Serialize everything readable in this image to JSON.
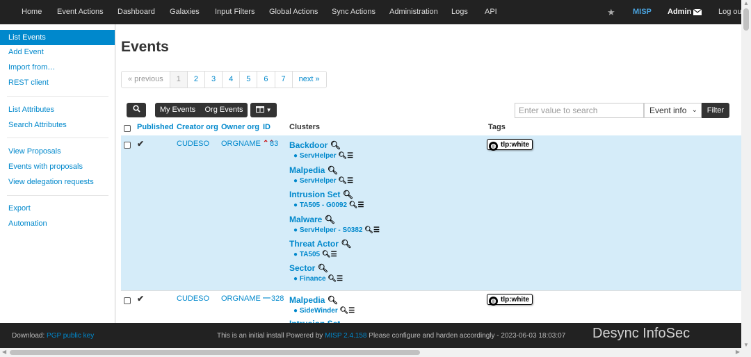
{
  "nav": {
    "home": "Home",
    "event_actions": "Event Actions",
    "dashboard": "Dashboard",
    "galaxies": "Galaxies",
    "input_filters": "Input Filters",
    "global_actions": "Global Actions",
    "sync_actions": "Sync Actions",
    "administration": "Administration",
    "logs": "Logs",
    "api": "API",
    "brand": "MISP",
    "user": "Admin",
    "logout": "Log out"
  },
  "sidebar": {
    "items": [
      "List Events",
      "Add Event",
      "Import from…",
      "REST client",
      "List Attributes",
      "Search Attributes",
      "View Proposals",
      "Events with proposals",
      "View delegation requests",
      "Export",
      "Automation"
    ]
  },
  "page": {
    "title": "Events"
  },
  "pagination": {
    "previous": "« previous",
    "pages": [
      "1",
      "2",
      "3",
      "4",
      "5",
      "6",
      "7"
    ],
    "next": "next »"
  },
  "toolbar": {
    "my_events": "My Events",
    "org_events": "Org Events",
    "search_placeholder": "Enter value to search",
    "field_select": "Event info",
    "filter": "Filter"
  },
  "table": {
    "headers": {
      "published": "Published",
      "creator_org": "Creator org",
      "owner_org": "Owner org",
      "id": "ID",
      "clusters": "Clusters",
      "tags": "Tags"
    },
    "rows": [
      {
        "creator_org": "CUDESO",
        "owner_org": "ORGNAME",
        "id": "83",
        "tag": "tlp:white",
        "clusters": [
          {
            "name": "Backdoor",
            "value": "ServHelper"
          },
          {
            "name": "Malpedia",
            "value": "ServHelper"
          },
          {
            "name": "Intrusion Set",
            "value": "TA505 - G0092"
          },
          {
            "name": "Malware",
            "value": "ServHelper - S0382"
          },
          {
            "name": "Threat Actor",
            "value": "TA505"
          },
          {
            "name": "Sector",
            "value": "Finance"
          }
        ]
      },
      {
        "creator_org": "CUDESO",
        "owner_org": "ORGNAME",
        "id": "328",
        "tag": "tlp:white",
        "clusters": [
          {
            "name": "Malpedia",
            "value": "SideWinder"
          },
          {
            "name": "Intrusion Set",
            "value": ""
          }
        ]
      }
    ]
  },
  "footer": {
    "download_label": "Download:",
    "pgp_link": "PGP public key",
    "notice_pre": "This is an initial install Powered by",
    "version": "MISP 2.4.158",
    "notice_post": "Please configure and harden accordingly - 2023-06-03 18:03:07",
    "watermark": "Desync InfoSec"
  }
}
